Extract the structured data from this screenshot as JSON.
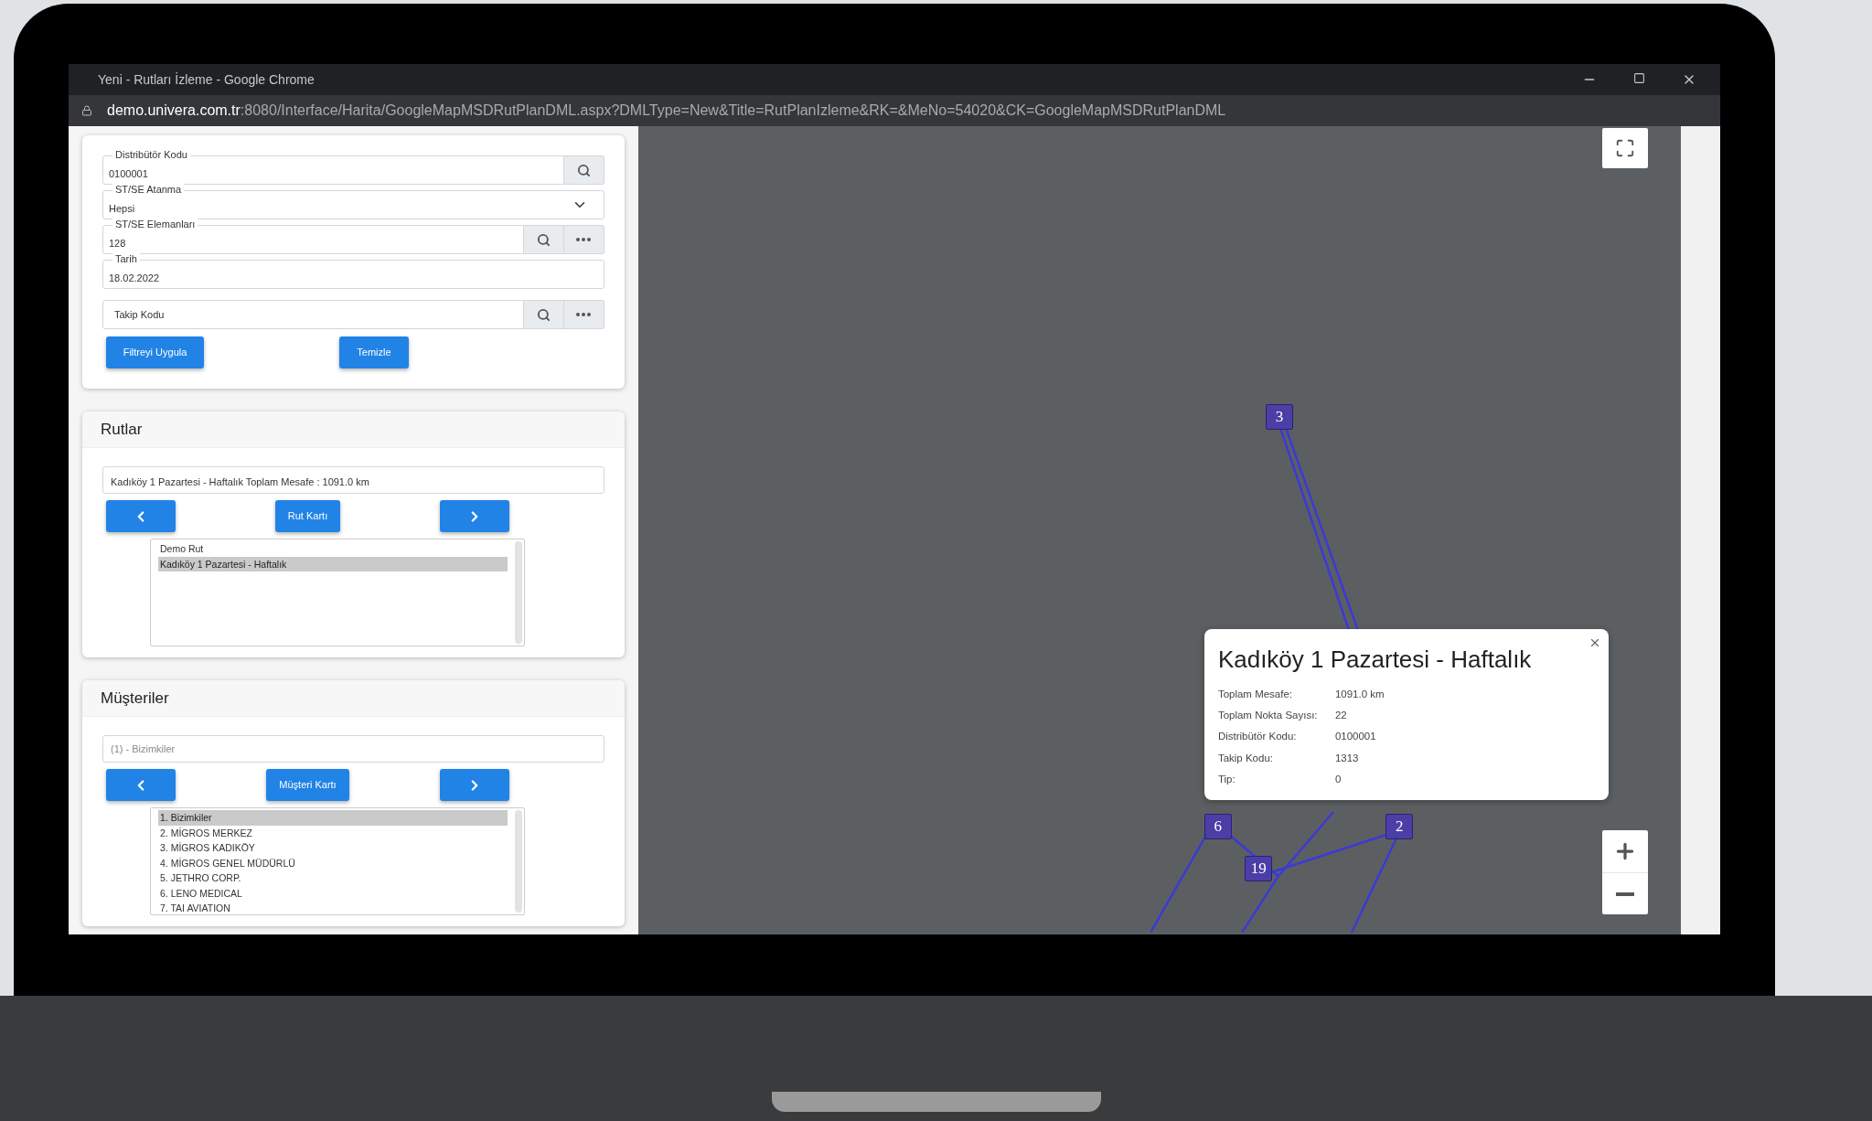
{
  "window": {
    "title": "Yeni - Rutları İzleme - Google Chrome",
    "url_host": "demo.univera.com.tr",
    "url_rest": ":8080/Interface/Harita/GoogleMapMSDRutPlanDML.aspx?DMLType=New&Title=RutPlanIzleme&RK=&MeNo=54020&CK=GoogleMapMSDRutPlanDML"
  },
  "filter": {
    "fields": [
      {
        "kind": "search",
        "label": "Distribütör Kodu",
        "value": "0100001"
      },
      {
        "kind": "select",
        "label": "ST/SE Atanma",
        "value": "Hepsi"
      },
      {
        "kind": "search_more",
        "label": "ST/SE Elemanları",
        "value": "128"
      },
      {
        "kind": "date",
        "label": "Tarih",
        "value": "18.02.2022"
      },
      {
        "kind": "search_more",
        "placeholder": "Takip Kodu"
      }
    ],
    "apply_button": "Filtreyi Uygula",
    "clear_button": "Temizle"
  },
  "routes": {
    "title": "Rutlar",
    "summary": "Kadıköy 1 Pazartesi - Haftalık Toplam Mesafe : 1091.0 km",
    "card_button": "Rut Kartı",
    "items": [
      {
        "label": "Demo Rut",
        "selected": false
      },
      {
        "label": "Kadıköy 1 Pazartesi - Haftalık",
        "selected": true
      }
    ]
  },
  "customers": {
    "title": "Müşteriler",
    "placeholder": "(1) - Bizimkiler",
    "card_button": "Müşteri Kartı",
    "items": [
      {
        "label": "1. Bizimkiler",
        "selected": true
      },
      {
        "label": "2. MİGROS MERKEZ",
        "selected": false
      },
      {
        "label": "3. MİGROS KADIKÖY",
        "selected": false
      },
      {
        "label": "4. MİGROS GENEL MÜDÜRLÜ",
        "selected": false
      },
      {
        "label": "5. JETHRO CORP.",
        "selected": false
      },
      {
        "label": "6. LENO MEDICAL",
        "selected": false
      },
      {
        "label": "7. TAI AVIATION",
        "selected": false
      }
    ]
  },
  "map": {
    "markers": [
      {
        "label": "3"
      },
      {
        "label": "6"
      },
      {
        "label": "2"
      },
      {
        "label": "19"
      }
    ],
    "popup": {
      "title": "Kadıköy 1 Pazartesi - Haftalık",
      "rows": [
        {
          "label": "Toplam Mesafe:",
          "value": "1091.0 km"
        },
        {
          "label": "Toplam Nokta Sayısı:",
          "value": "22"
        },
        {
          "label": "Distribütör Kodu:",
          "value": "0100001"
        },
        {
          "label": "Takip Kodu:",
          "value": "1313"
        },
        {
          "label": "Tip:",
          "value": "0"
        }
      ]
    }
  }
}
